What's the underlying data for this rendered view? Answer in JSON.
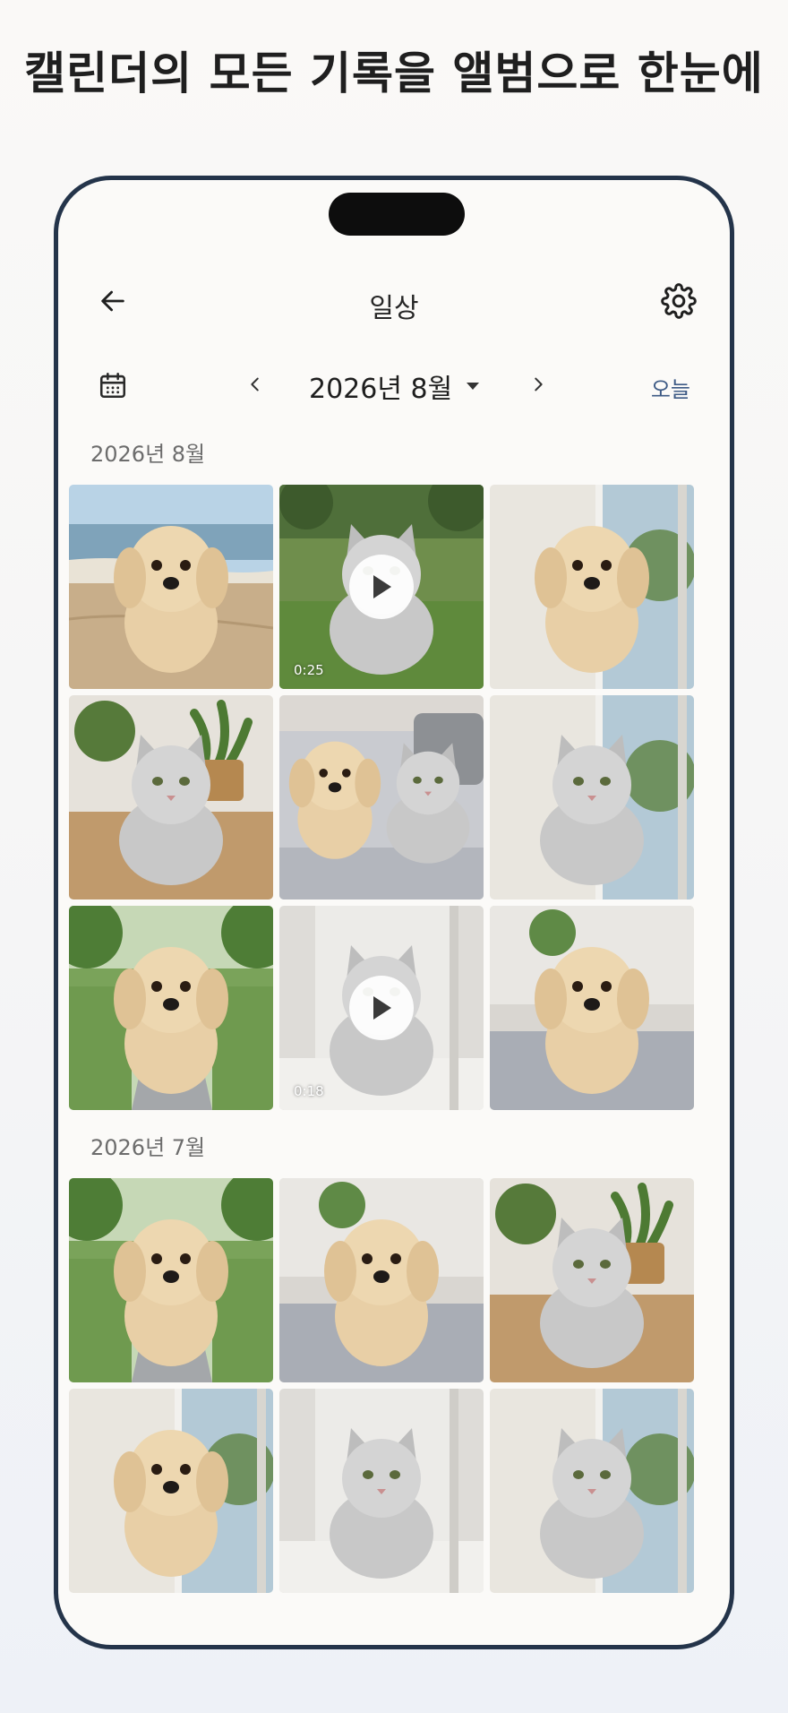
{
  "promo": {
    "title": "캘린더의 모든 기록을 앨범으로 한눈에"
  },
  "appbar": {
    "title": "일상",
    "back_icon": "arrow-left-icon",
    "settings_icon": "gear-icon"
  },
  "month_nav": {
    "label": "2026년 8월",
    "today_label": "오늘",
    "calendar_icon": "calendar-icon"
  },
  "sections": [
    {
      "label": "2026년 8월",
      "photos": [
        {
          "subject": "dog",
          "scene": "beach",
          "video": false
        },
        {
          "subject": "cat",
          "scene": "grass",
          "video": true,
          "duration": "0:25"
        },
        {
          "subject": "dog",
          "scene": "window",
          "video": false
        },
        {
          "subject": "cat",
          "scene": "plant-table",
          "video": false
        },
        {
          "subject": "dog-cat",
          "scene": "bed",
          "video": false
        },
        {
          "subject": "cat",
          "scene": "window",
          "video": false
        },
        {
          "subject": "dog",
          "scene": "park",
          "video": false
        },
        {
          "subject": "cat",
          "scene": "window-sill",
          "video": true,
          "duration": "0:18"
        },
        {
          "subject": "dog",
          "scene": "blanket",
          "video": false
        }
      ]
    },
    {
      "label": "2026년 7월",
      "photos": [
        {
          "subject": "dog",
          "scene": "park",
          "video": false
        },
        {
          "subject": "dog",
          "scene": "blanket",
          "video": false
        },
        {
          "subject": "cat",
          "scene": "plant-table",
          "video": false
        },
        {
          "subject": "dog",
          "scene": "window",
          "video": false
        },
        {
          "subject": "cat",
          "scene": "window-sill",
          "video": false
        },
        {
          "subject": "cat",
          "scene": "window",
          "video": false
        }
      ]
    }
  ],
  "colors": {
    "frame": "#24344a",
    "accent": "#3d5a85",
    "background": "#fbfaf8"
  }
}
